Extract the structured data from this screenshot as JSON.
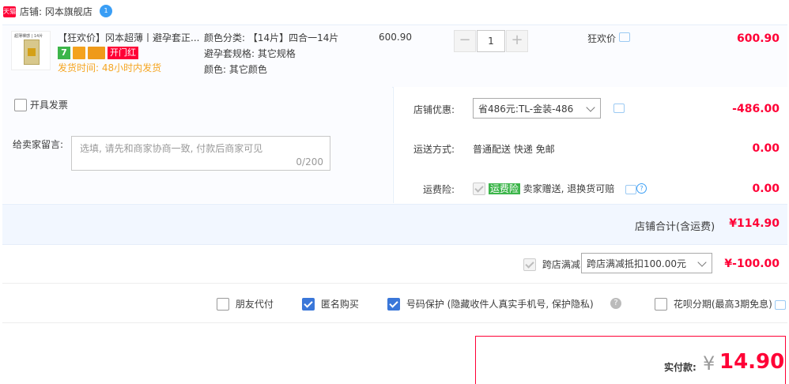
{
  "store": {
    "badge": "天猫",
    "label": "店铺: 冈本旗舰店",
    "chat_count": "1"
  },
  "item": {
    "title": "【狂欢价】冈本超薄丨避孕套正...",
    "icon7": "7",
    "icon_red": "开门红",
    "shipping": "发货时间: 48小时内发货",
    "sku_lines": [
      "颜色分类: 【14片】四合一14片",
      "避孕套规格: 其它规格",
      "颜色: 其它颜色"
    ],
    "unit_price": "600.90",
    "quantity": "1",
    "minus": "−",
    "plus": "+",
    "promo_label": "狂欢价",
    "subtotal": "600.90"
  },
  "invoice_label": "开具发票",
  "message": {
    "label": "给卖家留言:",
    "placeholder": "选填, 请先和商家协商一致, 付款后商家可见",
    "counter": "0/200"
  },
  "discount": {
    "label": "店铺优惠:",
    "selected": "省486元:TL-金装-486",
    "amount": "-486.00"
  },
  "delivery": {
    "label": "运送方式:",
    "value": "普通配送 快递 免邮",
    "amount": "0.00"
  },
  "insurance": {
    "label": "运费险:",
    "tag": "运费险",
    "text": "卖家赠送, 退换货可赔",
    "amount": "0.00"
  },
  "store_total": {
    "label": "店铺合计(含运费)",
    "amount": "¥114.90"
  },
  "cross_store": {
    "label": "跨店满减",
    "selected": "跨店满减抵扣100.00元",
    "amount": "¥-100.00"
  },
  "options": {
    "friend_pay": "朋友代付",
    "anonymous": "匿名购买",
    "number_protect": "号码保护 (隐藏收件人真实手机号, 保护隐私)",
    "huabei": "花呗分期(最高3期免息)"
  },
  "payment": {
    "label": "实付款:",
    "currency": "¥",
    "amount": "14.90"
  },
  "colors": {
    "accent_red": "#ff0036",
    "blue": "#3a77d9",
    "green": "#3cb54a",
    "orange": "#f5a623"
  }
}
